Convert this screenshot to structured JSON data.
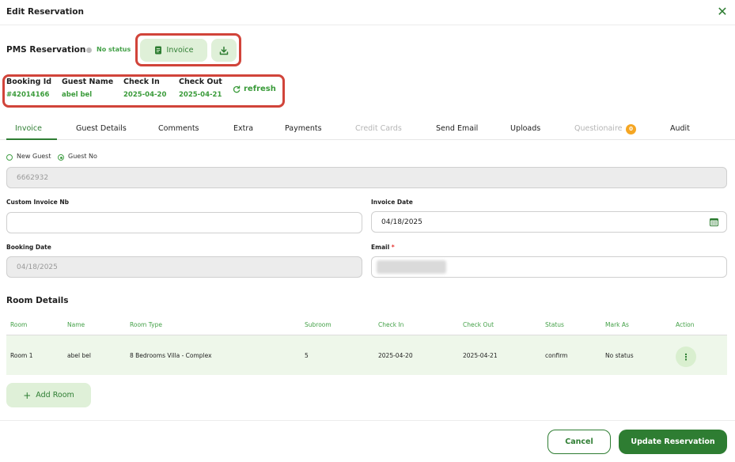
{
  "dialog": {
    "title": "Edit Reservation"
  },
  "header": {
    "label": "PMS Reservation",
    "status": "No status",
    "invoice_label": "Invoice"
  },
  "booking": {
    "id_label": "Booking Id",
    "id_value": "#42014166",
    "guest_label": "Guest Name",
    "guest_value": "abel bel",
    "checkin_label": "Check In",
    "checkin_value": "2025-04-20",
    "checkout_label": "Check Out",
    "checkout_value": "2025-04-21",
    "refresh_label": "refresh"
  },
  "tabs": [
    {
      "label": "Invoice"
    },
    {
      "label": "Guest Details"
    },
    {
      "label": "Comments"
    },
    {
      "label": "Extra"
    },
    {
      "label": "Payments"
    },
    {
      "label": "Credit Cards"
    },
    {
      "label": "Send Email"
    },
    {
      "label": "Uploads"
    },
    {
      "label": "Questionaire"
    },
    {
      "label": "Audit"
    }
  ],
  "questionaire_badge": "0",
  "form": {
    "new_guest_label": "New Guest",
    "guest_no_label": "Guest No",
    "guest_no_value": "6662932",
    "custom_invoice_label": "Custom Invoice Nb",
    "custom_invoice_value": "",
    "invoice_date_label": "Invoice Date",
    "invoice_date_value": "04/18/2025",
    "booking_date_label": "Booking Date",
    "booking_date_value": "04/18/2025",
    "email_label": "Email",
    "email_required": "*"
  },
  "rooms": {
    "title": "Room Details",
    "columns": [
      "Room",
      "Name",
      "Room Type",
      "Subroom",
      "Check In",
      "Check Out",
      "Status",
      "Mark As",
      "Action"
    ],
    "rows": [
      {
        "room": "Room 1",
        "name": "abel bel",
        "room_type": "8 Bedrooms Villa - Complex",
        "subroom": "5",
        "check_in": "2025-04-20",
        "check_out": "2025-04-21",
        "status": "confirm",
        "mark_as": "No status"
      }
    ],
    "add_label": "Add Room"
  },
  "footer": {
    "cancel_label": "Cancel",
    "update_label": "Update Reservation"
  },
  "colors": {
    "accent": "#2e7d32",
    "highlight_border": "#d1443a",
    "badge": "#f5a623"
  }
}
